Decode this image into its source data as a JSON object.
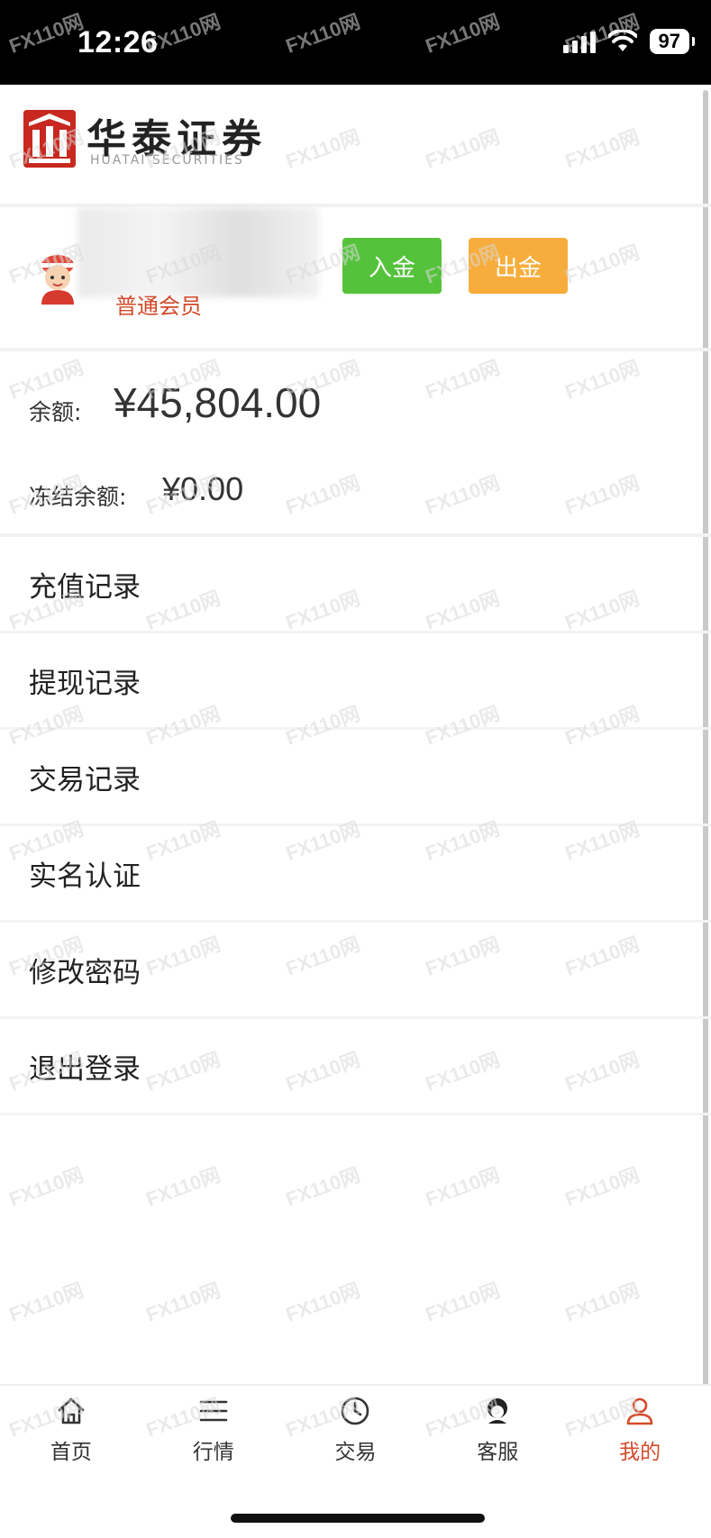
{
  "status_bar": {
    "time": "12:26",
    "battery": "97"
  },
  "header": {
    "brand_cn": "华泰证券",
    "brand_en": "HUATAI SECURITIES"
  },
  "member": {
    "level": "普通会员",
    "deposit_label": "入金",
    "withdraw_label": "出金"
  },
  "balance": {
    "label": "余额:",
    "value": "¥45,804.00",
    "frozen_label": "冻结余额:",
    "frozen_value": "¥0.00"
  },
  "menu": [
    {
      "label": "充值记录"
    },
    {
      "label": "提现记录"
    },
    {
      "label": "交易记录"
    },
    {
      "label": "实名认证"
    },
    {
      "label": "修改密码"
    },
    {
      "label": "退出登录"
    }
  ],
  "tabbar": [
    {
      "label": "首页",
      "icon": "home-icon"
    },
    {
      "label": "行情",
      "icon": "list-icon"
    },
    {
      "label": "交易",
      "icon": "clock-icon"
    },
    {
      "label": "客服",
      "icon": "support-icon"
    },
    {
      "label": "我的",
      "icon": "user-icon",
      "active": true
    }
  ],
  "watermark": "FX110网",
  "colors": {
    "brand_red": "#c8281f",
    "deposit_green": "#55c23c",
    "withdraw_orange": "#f7ad3c",
    "accent": "#d34a2a"
  }
}
